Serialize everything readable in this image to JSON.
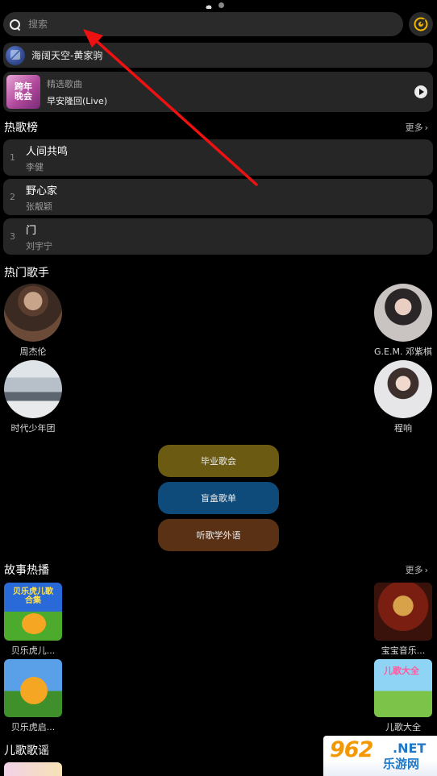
{
  "search": {
    "placeholder": "搜索"
  },
  "now_playing": {
    "title": "海阔天空-黄家驹"
  },
  "featured": {
    "label": "精选歌曲",
    "song": "早安隆回(Live)",
    "thumb_text": "跨年晚会"
  },
  "hot_songs": {
    "title": "热歌榜",
    "more": "更多",
    "items": [
      {
        "rank": "1",
        "title": "人间共鸣",
        "artist": "李健"
      },
      {
        "rank": "2",
        "title": "野心家",
        "artist": "张靓颖"
      },
      {
        "rank": "3",
        "title": "门",
        "artist": "刘宇宁"
      }
    ]
  },
  "hot_singers": {
    "title": "热门歌手",
    "items": [
      {
        "name": "周杰伦"
      },
      {
        "name": "G.E.M. 邓紫棋"
      },
      {
        "name": "时代少年团"
      },
      {
        "name": "程响"
      }
    ]
  },
  "playlists": [
    {
      "label": "毕业歌会",
      "color": "#6b5a12"
    },
    {
      "label": "盲盒歌单",
      "color": "#0e4a7a"
    },
    {
      "label": "听歌学外语",
      "color": "#5a3115"
    }
  ],
  "stories": {
    "title": "故事热播",
    "more": "更多",
    "items": [
      {
        "name": "贝乐虎儿...",
        "thumb_text": "贝乐虎儿歌合集"
      },
      {
        "name": "宝宝音乐..."
      },
      {
        "name": "贝乐虎启..."
      },
      {
        "name": "儿歌大全",
        "thumb_text": "儿歌大全"
      }
    ]
  },
  "kids_songs": {
    "title": "儿歌歌谣"
  },
  "watermark": {
    "big": "962",
    "net": ".NET",
    "small": "乐游网"
  }
}
